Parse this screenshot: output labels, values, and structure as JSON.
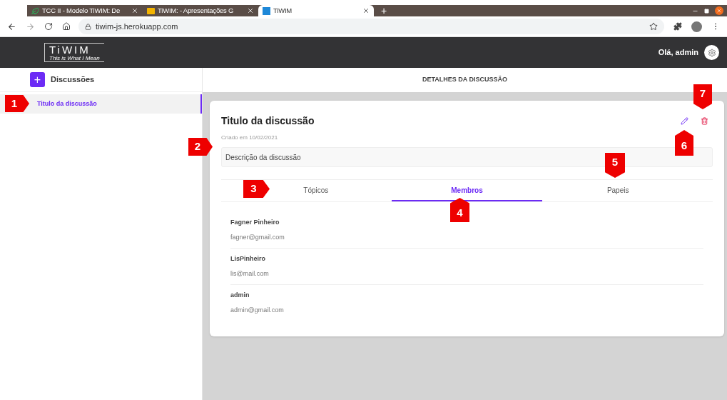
{
  "browser": {
    "tabs": [
      {
        "title": "TCC II - Modelo TiWIM: De",
        "selected": false
      },
      {
        "title": "TiWIM: - Apresentações G",
        "selected": false
      },
      {
        "title": "TiWIM",
        "selected": true
      }
    ],
    "new_tab": "+",
    "url": "tiwim-js.herokuapp.com"
  },
  "header": {
    "logo": "TiWIM",
    "tagline": "This is What I Mean",
    "greeting": "Olá, admin"
  },
  "sidebar": {
    "title": "Discussões",
    "add": "+",
    "items": [
      {
        "label": "Titulo da discussão",
        "selected": true
      }
    ]
  },
  "main": {
    "title": "DETALHES DA DISCUSSÃO"
  },
  "card": {
    "title": "Titulo da discussão",
    "created": "Criado em 10/02/2021",
    "description": "Descrição da discussão",
    "tabs": [
      {
        "label": "Tópicos",
        "selected": false
      },
      {
        "label": "Membros",
        "selected": true
      },
      {
        "label": "Papeis",
        "selected": false
      }
    ],
    "members": [
      {
        "name": "Fagner Pinheiro",
        "email": "fagner@gmail.com"
      },
      {
        "name": "LisPinheiro",
        "email": "lis@mail.com"
      },
      {
        "name": "admin",
        "email": "admin@gmail.com"
      }
    ]
  },
  "callouts": [
    {
      "label": "1"
    },
    {
      "label": "2"
    },
    {
      "label": "3"
    },
    {
      "label": "4"
    },
    {
      "label": "5"
    },
    {
      "label": "6"
    },
    {
      "label": "7"
    }
  ]
}
